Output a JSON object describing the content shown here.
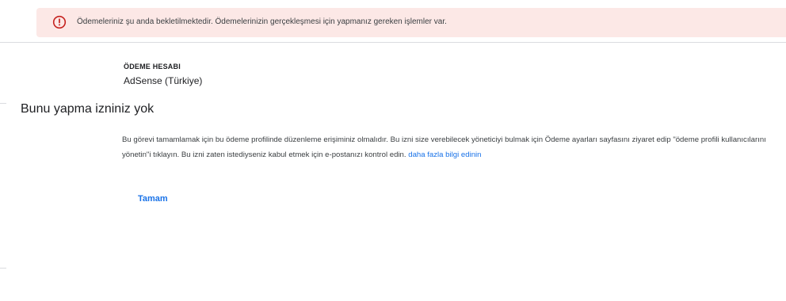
{
  "alert": {
    "icon": "error-icon",
    "message": "Ödemeleriniz şu anda bekletilmektedir. Ödemelerinizin gerçekleşmesi için yapmanız gereken işlemler var.",
    "color": "#c5221f",
    "background": "#fce8e6"
  },
  "payment_account": {
    "label": "ÖDEME HESABI",
    "value": "AdSense (Türkiye)"
  },
  "dialog": {
    "title": "Bunu yapma izniniz yok",
    "body": "Bu görevi tamamlamak için bu ödeme profilinde düzenleme erişiminiz olmalıdır. Bu izni size verebilecek yöneticiyi bulmak için Ödeme ayarları sayfasını ziyaret edip \"ödeme profili kullanıcılarını yönetin\"i tıklayın. Bu izni zaten istediyseniz kabul etmek için e-postanızı kontrol edin.",
    "learn_more": "daha fazla bilgi edinin",
    "ok_label": "Tamam"
  },
  "colors": {
    "link": "#1a73e8",
    "text": "#202124",
    "divider": "#dadce0"
  }
}
